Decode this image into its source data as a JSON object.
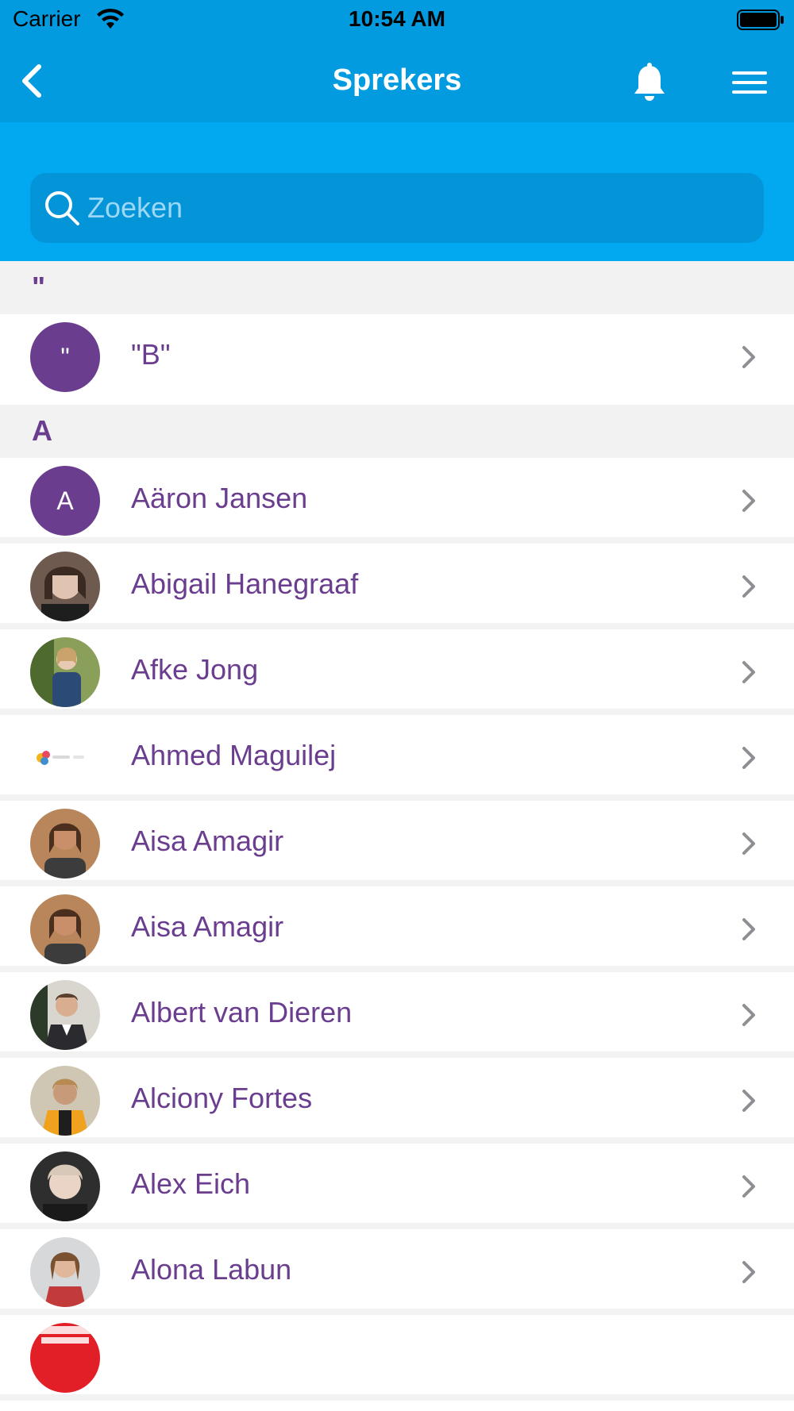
{
  "status_bar": {
    "carrier": "Carrier",
    "time": "10:54 AM"
  },
  "nav": {
    "title": "Sprekers",
    "back_icon": "chevron-left-icon",
    "bell_icon": "bell-icon",
    "menu_icon": "hamburger-menu-icon"
  },
  "search": {
    "placeholder": "Zoeken",
    "value": ""
  },
  "colors": {
    "nav_bg": "#039be0",
    "search_bg": "#03a9f0",
    "accent_purple": "#6b3d8f",
    "section_bg": "#f2f2f2"
  },
  "sections": [
    {
      "header": "\"",
      "items": [
        {
          "name": "\"B\"",
          "avatar_letter": "\""
        }
      ]
    },
    {
      "header": "A",
      "items": [
        {
          "name": "Aäron Jansen",
          "avatar_letter": "A"
        },
        {
          "name": "Abigail Hanegraaf",
          "avatar_letter": ""
        },
        {
          "name": "Afke Jong",
          "avatar_letter": ""
        },
        {
          "name": "Ahmed Maguilej",
          "avatar_letter": ""
        },
        {
          "name": "Aisa Amagir",
          "avatar_letter": ""
        },
        {
          "name": "Aisa Amagir",
          "avatar_letter": ""
        },
        {
          "name": "Albert van Dieren",
          "avatar_letter": ""
        },
        {
          "name": "Alciony Fortes",
          "avatar_letter": ""
        },
        {
          "name": "Alex Eich",
          "avatar_letter": ""
        },
        {
          "name": "Alona Labun",
          "avatar_letter": ""
        }
      ]
    }
  ]
}
